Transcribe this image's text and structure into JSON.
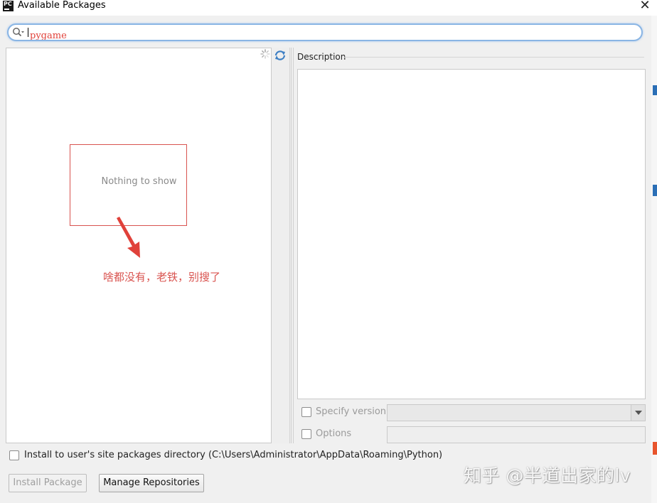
{
  "window": {
    "app_icon_text": "PC",
    "title": "Available Packages",
    "close_label": "✕"
  },
  "search": {
    "value": "pygame"
  },
  "package_list": {
    "empty_message": "Nothing to show",
    "annotation": "啥都没有，老铁，别搜了"
  },
  "description": {
    "label": "Description"
  },
  "options": {
    "specify_version_label": "Specify version",
    "options_label": "Options",
    "user_site_label": "Install to user's site packages directory (C:\\Users\\Administrator\\AppData\\Roaming\\Python)"
  },
  "buttons": {
    "install": "Install Package",
    "manage": "Manage Repositories"
  },
  "watermark": "知乎 @半道出家的lv",
  "colors": {
    "annotation": "#d9534f",
    "search_text": "#e0413a",
    "focus_border": "#8ab5e4"
  }
}
